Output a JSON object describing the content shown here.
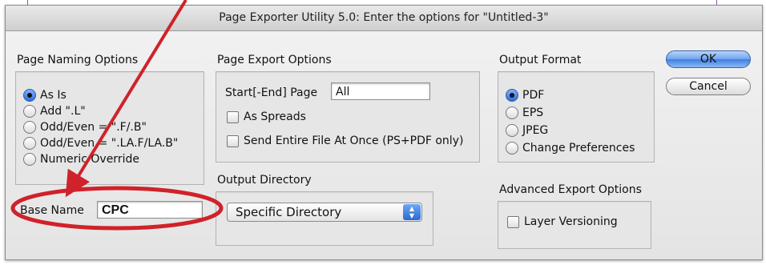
{
  "window": {
    "title": "Page Exporter Utility 5.0: Enter the options for \"Untitled-3\""
  },
  "page_naming": {
    "heading": "Page Naming Options",
    "options": [
      {
        "label": "As Is",
        "selected": true
      },
      {
        "label": "Add \".L\"",
        "selected": false
      },
      {
        "label": "Odd/Even = \".F/.B\"",
        "selected": false
      },
      {
        "label": "Odd/Even = \".LA.F/LA.B\"",
        "selected": false
      },
      {
        "label": "Numeric Override",
        "selected": false
      }
    ],
    "base_name_label": "Base Name",
    "base_name_value": "CPC"
  },
  "page_export": {
    "heading": "Page Export Options",
    "start_end_label": "Start[-End] Page",
    "start_end_value": "All",
    "as_spreads_label": "As Spreads",
    "send_entire_label": "Send Entire File At Once (PS+PDF only)"
  },
  "output_directory": {
    "heading": "Output Directory",
    "selected": "Specific Directory"
  },
  "output_format": {
    "heading": "Output Format",
    "options": [
      {
        "label": "PDF",
        "selected": true
      },
      {
        "label": "EPS",
        "selected": false
      },
      {
        "label": "JPEG",
        "selected": false
      },
      {
        "label": "Change Preferences",
        "selected": false
      }
    ]
  },
  "advanced": {
    "heading": "Advanced Export Options",
    "layer_versioning_label": "Layer Versioning"
  },
  "buttons": {
    "ok": "OK",
    "cancel": "Cancel"
  },
  "annotation": {
    "color": "#d0222a"
  },
  "colors": {
    "default_button": "#4a86e4",
    "annotation_red": "#d0222a"
  }
}
